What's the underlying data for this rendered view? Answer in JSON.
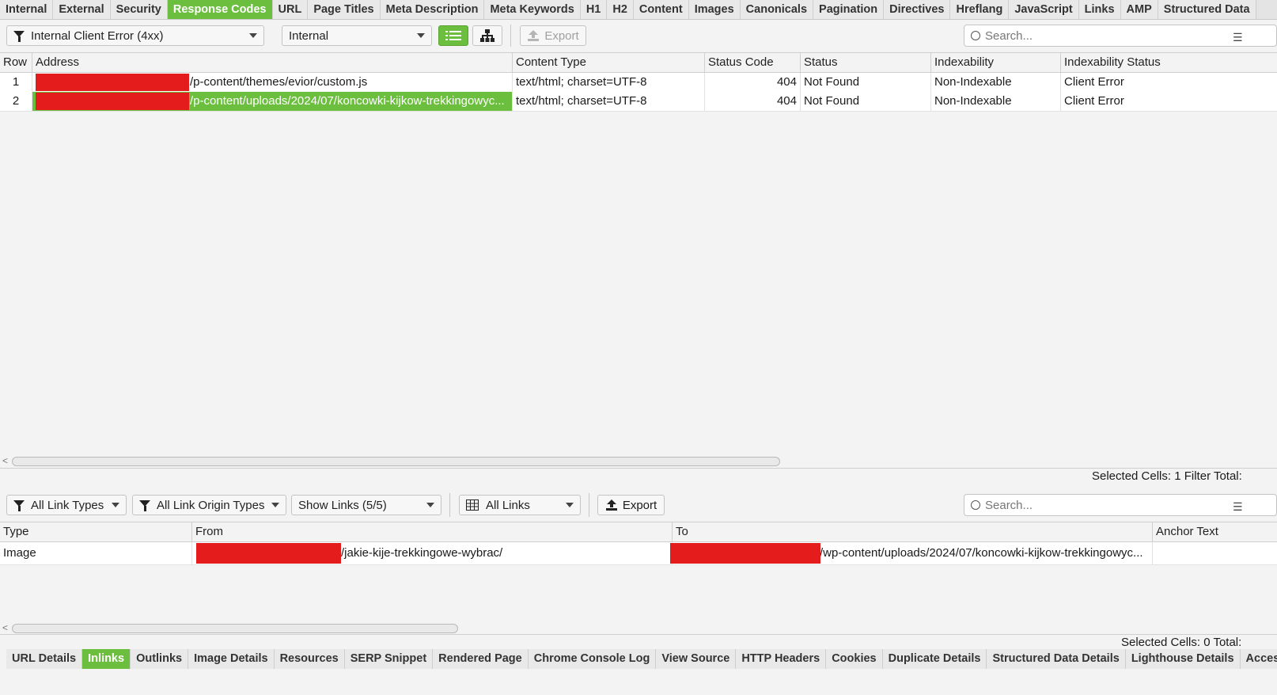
{
  "top_tabs": [
    "Internal",
    "External",
    "Security",
    "Response Codes",
    "URL",
    "Page Titles",
    "Meta Description",
    "Meta Keywords",
    "H1",
    "H2",
    "Content",
    "Images",
    "Canonicals",
    "Pagination",
    "Directives",
    "Hreflang",
    "JavaScript",
    "Links",
    "AMP",
    "Structured Data"
  ],
  "top_active_tab": "Response Codes",
  "upper_toolbar": {
    "filter_label": "Internal Client Error (4xx)",
    "scope_label": "Internal",
    "export_label": "Export",
    "search_placeholder": "Search..."
  },
  "upper_table": {
    "columns": [
      "Row",
      "Address",
      "Content Type",
      "Status Code",
      "Status",
      "Indexability",
      "Indexability Status"
    ],
    "rows": [
      {
        "row": "1",
        "address": "/p-content/themes/evior/custom.js",
        "content_type": "text/html; charset=UTF-8",
        "status_code": "404",
        "status": "Not Found",
        "indexability": "Non-Indexable",
        "indexability_status": "Client Error"
      },
      {
        "row": "2",
        "address": "/p-content/uploads/2024/07/koncowki-kijkow-trekkingowyc...",
        "content_type": "text/html; charset=UTF-8",
        "status_code": "404",
        "status": "Not Found",
        "indexability": "Non-Indexable",
        "indexability_status": "Client Error"
      }
    ],
    "status_text": "Selected Cells:  1  Filter Total:"
  },
  "lower_toolbar": {
    "link_types_label": "All Link Types",
    "link_origin_label": "All Link Origin Types",
    "show_links_label": "Show Links (5/5)",
    "all_links_label": "All Links",
    "export_label": "Export",
    "search_placeholder": "Search..."
  },
  "lower_table": {
    "columns": [
      "Type",
      "From",
      "To",
      "Anchor Text"
    ],
    "rows": [
      {
        "type": "Image",
        "from": "/jakie-kije-trekkingowe-wybrac/",
        "to": "/wp-content/uploads/2024/07/koncowki-kijkow-trekkingowyc...",
        "anchor": ""
      }
    ],
    "status_text": "Selected Cells:  0  Total:"
  },
  "bottom_tabs": [
    "URL Details",
    "Inlinks",
    "Outlinks",
    "Image Details",
    "Resources",
    "SERP Snippet",
    "Rendered Page",
    "Chrome Console Log",
    "View Source",
    "HTTP Headers",
    "Cookies",
    "Duplicate Details",
    "Structured Data Details",
    "Lighthouse Details",
    "Access"
  ],
  "bottom_active_tab": "Inlinks",
  "colors": {
    "accent": "#6cbf3e",
    "redaction": "#e51c1c"
  }
}
